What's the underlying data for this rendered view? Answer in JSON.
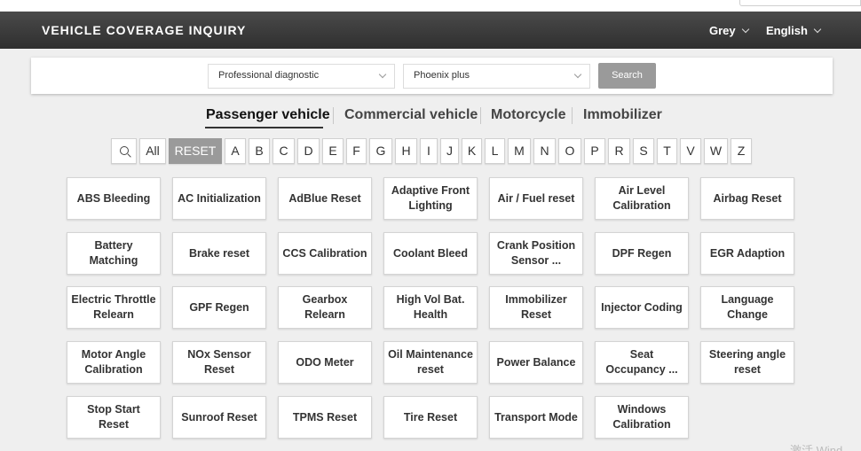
{
  "header": {
    "title": "VEHICLE COVERAGE INQUIRY",
    "theme": "Grey",
    "language": "English"
  },
  "search": {
    "category_value": "Professional diagnostic",
    "device_value": "Phoenix plus",
    "button": "Search"
  },
  "tabs": [
    "Passenger vehicle",
    "Commercial vehicle",
    "Motorcycle",
    "Immobilizer"
  ],
  "letters": [
    "All",
    "RESET",
    "A",
    "B",
    "C",
    "D",
    "E",
    "F",
    "G",
    "H",
    "I",
    "J",
    "K",
    "L",
    "M",
    "N",
    "O",
    "P",
    "R",
    "S",
    "T",
    "V",
    "W",
    "Z"
  ],
  "functions": [
    [
      "ABS Bleeding",
      "AC Initialization",
      "AdBlue Reset",
      "Adaptive Front Lighting",
      "Air / Fuel reset",
      "Air Level Calibration",
      "Airbag Reset"
    ],
    [
      "Battery Matching",
      "Brake reset",
      "CCS Calibration",
      "Coolant Bleed",
      "Crank Position Sensor ...",
      "DPF Regen",
      "EGR Adaption"
    ],
    [
      "Electric Throttle Relearn",
      "GPF Regen",
      "Gearbox Relearn",
      "High Vol Bat. Health",
      "Immobilizer Reset",
      "Injector Coding",
      "Language Change"
    ],
    [
      "Motor Angle Calibration",
      "NOx Sensor Reset",
      "ODO Meter",
      "Oil Maintenance reset",
      "Power Balance",
      "Seat Occupancy ...",
      "Steering angle reset"
    ],
    [
      "Stop Start Reset",
      "Sunroof Reset",
      "TPMS Reset",
      "Tire Reset",
      "Transport Mode",
      "Windows Calibration"
    ]
  ],
  "watermark": "激活 Wind"
}
